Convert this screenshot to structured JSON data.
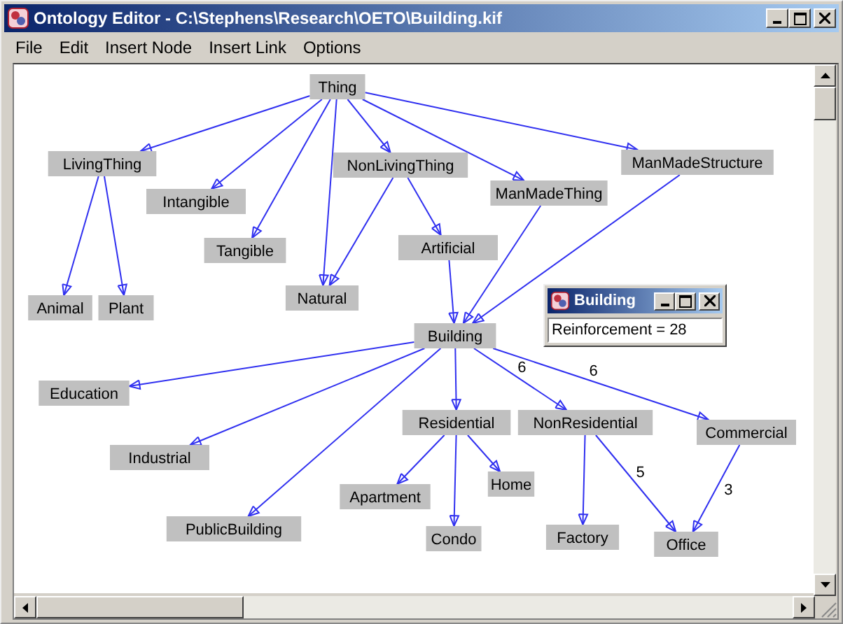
{
  "window": {
    "title": "Ontology Editor - C:\\Stephens\\Research\\OETO\\Building.kif"
  },
  "menu": [
    "File",
    "Edit",
    "Insert Node",
    "Insert Link",
    "Options"
  ],
  "nodes": [
    {
      "label": "Thing"
    },
    {
      "label": "LivingThing"
    },
    {
      "label": "Intangible"
    },
    {
      "label": "Tangible"
    },
    {
      "label": "NonLivingThing"
    },
    {
      "label": "ManMadeThing"
    },
    {
      "label": "ManMadeStructure"
    },
    {
      "label": "Artificial"
    },
    {
      "label": "Natural"
    },
    {
      "label": "Animal"
    },
    {
      "label": "Plant"
    },
    {
      "label": "Building"
    },
    {
      "label": "Education"
    },
    {
      "label": "Industrial"
    },
    {
      "label": "Residential"
    },
    {
      "label": "NonResidential"
    },
    {
      "label": "Commercial"
    },
    {
      "label": "Apartment"
    },
    {
      "label": "Home"
    },
    {
      "label": "Condo"
    },
    {
      "label": "Factory"
    },
    {
      "label": "Office"
    },
    {
      "label": "PublicBuilding"
    }
  ],
  "edge_labels": [
    "6",
    "6",
    "5",
    "3"
  ],
  "popup": {
    "title": "Building",
    "text": "Reinforcement = 28"
  }
}
